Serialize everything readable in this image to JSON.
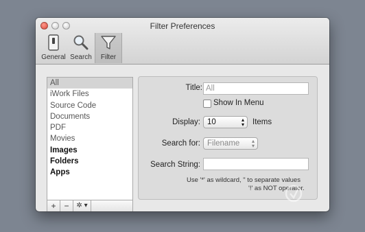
{
  "window": {
    "title": "Filter Preferences"
  },
  "toolbar": {
    "items": [
      {
        "label": "General",
        "icon": "general-switch-icon"
      },
      {
        "label": "Search",
        "icon": "magnifier-icon"
      },
      {
        "label": "Filter",
        "icon": "funnel-icon",
        "active": true
      }
    ]
  },
  "sidebar": {
    "items": [
      {
        "label": "All",
        "selected": true
      },
      {
        "label": "iWork Files"
      },
      {
        "label": "Source Code"
      },
      {
        "label": "Documents"
      },
      {
        "label": "PDF"
      },
      {
        "label": "Movies"
      },
      {
        "label": "Images",
        "bold": true
      },
      {
        "label": "Folders",
        "bold": true
      },
      {
        "label": "Apps",
        "bold": true
      }
    ],
    "footer": {
      "add": "+",
      "remove": "−",
      "gear": "✲ ▾"
    }
  },
  "settings": {
    "title_label": "Title:",
    "title_value": "All",
    "show_in_menu_label": "Show In Menu",
    "display_label": "Display:",
    "display_value": "10",
    "display_unit": "Items",
    "search_for_label": "Search for:",
    "search_for_value": "Filename",
    "search_string_label": "Search String:",
    "search_string_value": "",
    "hint_line1": "Use '*' as wildcard, \" to separate values",
    "hint_line2": "'!' as NOT operator."
  },
  "watermark": {
    "text": "当下软件园",
    "url": "www.downxia.com"
  },
  "colors": {
    "accent": "#d9473a",
    "selection": "#d4d4d4"
  }
}
